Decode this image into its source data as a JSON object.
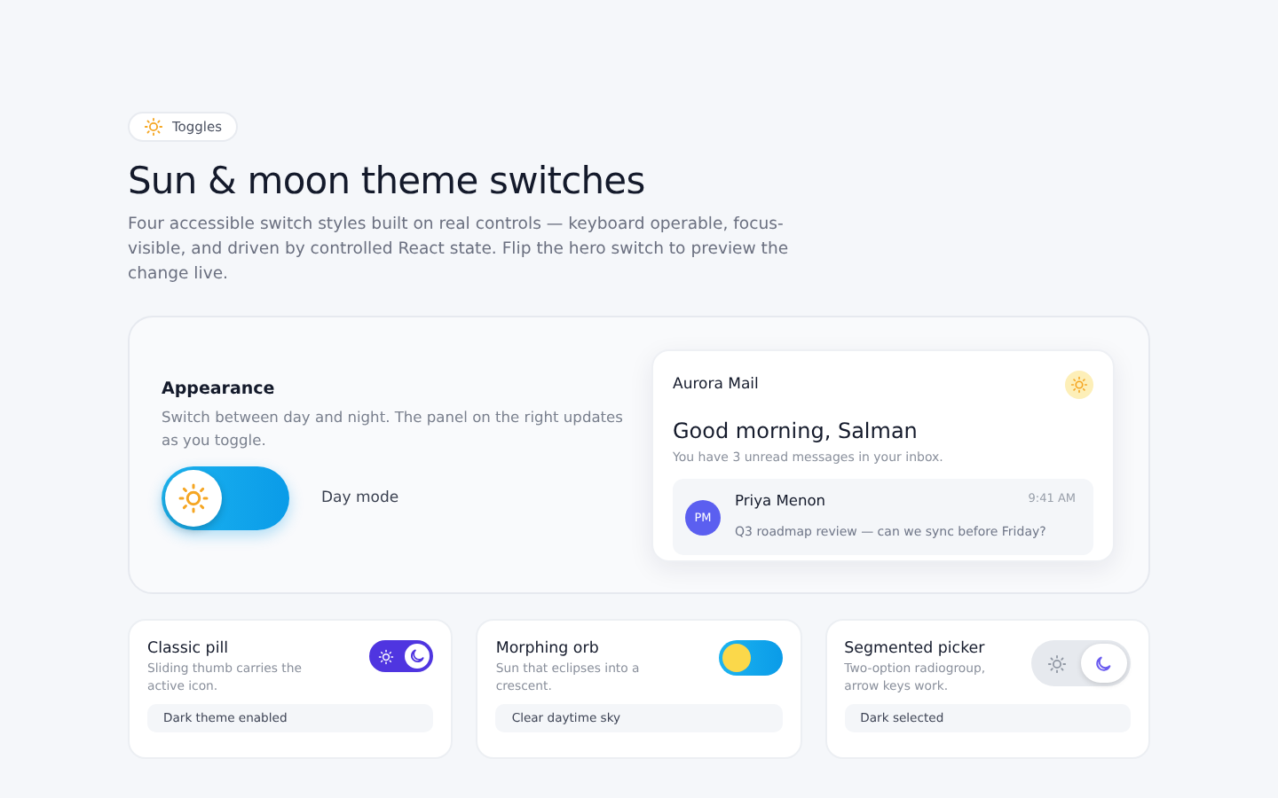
{
  "badge": {
    "label": "Toggles"
  },
  "title": "Sun & moon theme switches",
  "subtitle": "Four accessible switch styles built on real controls — keyboard operable, focus-visible, and driven by controlled React state. Flip the hero switch to preview the change live.",
  "hero": {
    "heading": "Appearance",
    "description": "Switch between day and night. The panel on the right updates as you toggle.",
    "on": false,
    "label": "Day mode"
  },
  "preview": {
    "app_name": "Aurora Mail",
    "greeting": "Good morning, Salman",
    "summary": "You have 3 unread messages in your inbox.",
    "message": {
      "initials": "PM",
      "sender": "Priya Menon",
      "time": "9:41 AM",
      "subject": "Q3 roadmap review — can we sync before Friday?"
    }
  },
  "cards": [
    {
      "kind": "pill",
      "title": "Classic pill",
      "description": "Sliding thumb carries the active icon.",
      "on": true,
      "status": "Dark theme enabled"
    },
    {
      "kind": "orb",
      "title": "Morphing orb",
      "description": "Sun that eclipses into a crescent.",
      "on": false,
      "status": "Clear daytime sky"
    },
    {
      "kind": "segmented",
      "title": "Segmented picker",
      "description": "Two-option radiogroup, arrow keys work.",
      "on": true,
      "status": "Dark selected"
    }
  ]
}
